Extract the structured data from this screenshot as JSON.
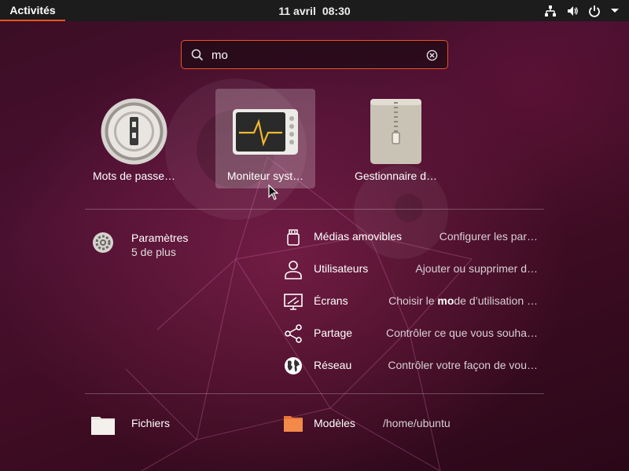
{
  "topbar": {
    "activities": "Activités",
    "date": "11 avril",
    "time": "08:30"
  },
  "search": {
    "value": "mo",
    "placeholder": ""
  },
  "apps": [
    {
      "label": "Mots de passe…",
      "icon": "key-lock-icon"
    },
    {
      "label": "Moniteur syst…",
      "icon": "system-monitor-icon"
    },
    {
      "label": "Gestionnaire d…",
      "icon": "archive-zipper-icon"
    }
  ],
  "settings_provider": {
    "title": "Paramètres",
    "subtitle": "5 de plus",
    "results": [
      {
        "title": "Médias amovibles",
        "desc": "Configurer les par…",
        "icon": "usb-drive-icon"
      },
      {
        "title": "Utilisateurs",
        "desc": "Ajouter ou supprimer d…",
        "icon": "user-icon"
      },
      {
        "title": "Écrans",
        "desc_pre": "Choisir le ",
        "desc_match": "mo",
        "desc_post": "de d’utilisation …",
        "icon": "display-icon"
      },
      {
        "title": "Partage",
        "desc": "Contrôler ce que vous souha…",
        "icon": "share-icon"
      },
      {
        "title": "Réseau",
        "desc": "Contrôler votre façon de vou…",
        "icon": "globe-icon"
      }
    ]
  },
  "files_provider": {
    "title": "Fichiers",
    "result_title": "Modèles",
    "result_path": "/home/ubuntu"
  },
  "colors": {
    "accent": "#e95420",
    "topbar": "#1c1c1c",
    "background": "#4a1030"
  }
}
